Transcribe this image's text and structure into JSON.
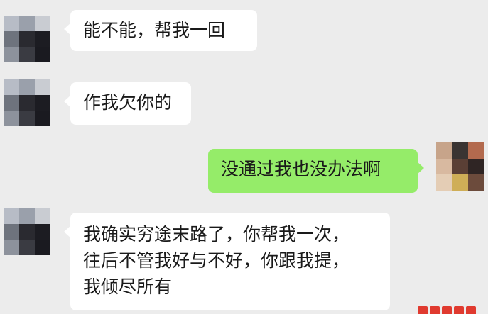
{
  "chat": {
    "messages": [
      {
        "side": "left",
        "lines": [
          "能不能，帮我一回"
        ]
      },
      {
        "side": "left",
        "lines": [
          "作我欠你的"
        ]
      },
      {
        "side": "right",
        "lines": [
          "没通过我也没办法啊"
        ]
      },
      {
        "side": "left",
        "lines": [
          "我确实穷途末路了，你帮我一次，",
          "往后不管我好与不好，你跟我提，",
          "我倾尽所有"
        ]
      }
    ]
  },
  "colors": {
    "background": "#ececec",
    "incoming_bubble": "#ffffff",
    "outgoing_bubble": "#95ec69",
    "watermark": "#e03a2f"
  },
  "icons": {
    "contact_avatar": "pixelated-avatar-icon",
    "self_avatar": "pixelated-avatar-icon"
  }
}
